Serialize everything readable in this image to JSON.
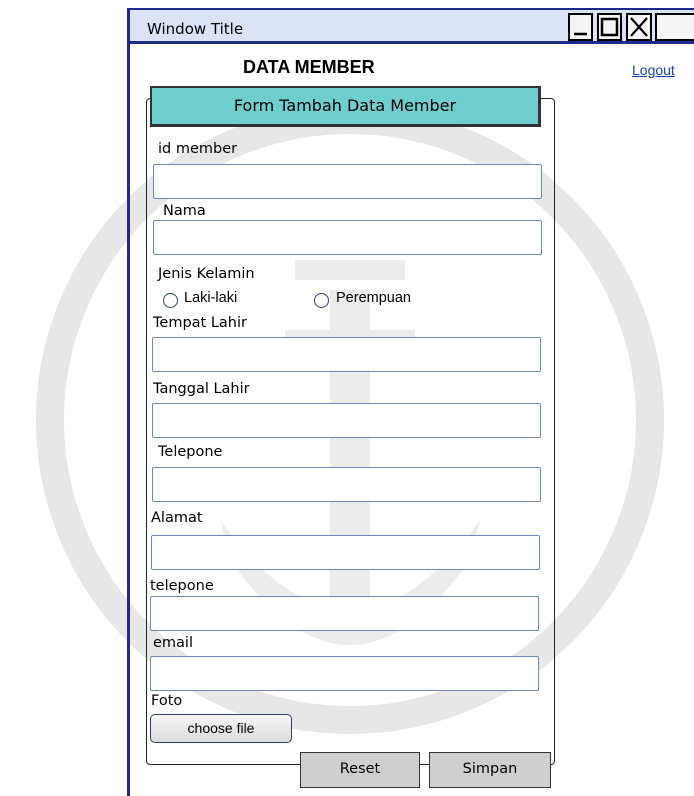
{
  "window": {
    "title": "Window Title"
  },
  "header": {
    "heading": "DATA MEMBER",
    "logout": "Logout"
  },
  "form": {
    "title": "Form Tambah Data Member",
    "fields": {
      "id_member": {
        "label": "id member",
        "value": ""
      },
      "nama": {
        "label": "Nama",
        "value": ""
      },
      "jenis_kelamin": {
        "label": "Jenis Kelamin",
        "options": [
          "Laki-laki",
          "Perempuan"
        ]
      },
      "tempat_lahir": {
        "label": "Tempat Lahir",
        "value": ""
      },
      "tanggal_lahir": {
        "label": "Tanggal Lahir",
        "value": ""
      },
      "telepone": {
        "label": "Telepone",
        "value": ""
      },
      "alamat": {
        "label": "Alamat",
        "value": ""
      },
      "telepone2": {
        "label": "telepone",
        "value": ""
      },
      "email": {
        "label": "email",
        "value": ""
      },
      "foto": {
        "label": "Foto",
        "button": "choose file"
      }
    },
    "buttons": {
      "reset": "Reset",
      "simpan": "Simpan"
    }
  },
  "colors": {
    "frame": "#1f2a8a",
    "form_title_bg": "#6fcfcf",
    "link": "#1a3fb8",
    "field_border": "#6f86b8"
  }
}
